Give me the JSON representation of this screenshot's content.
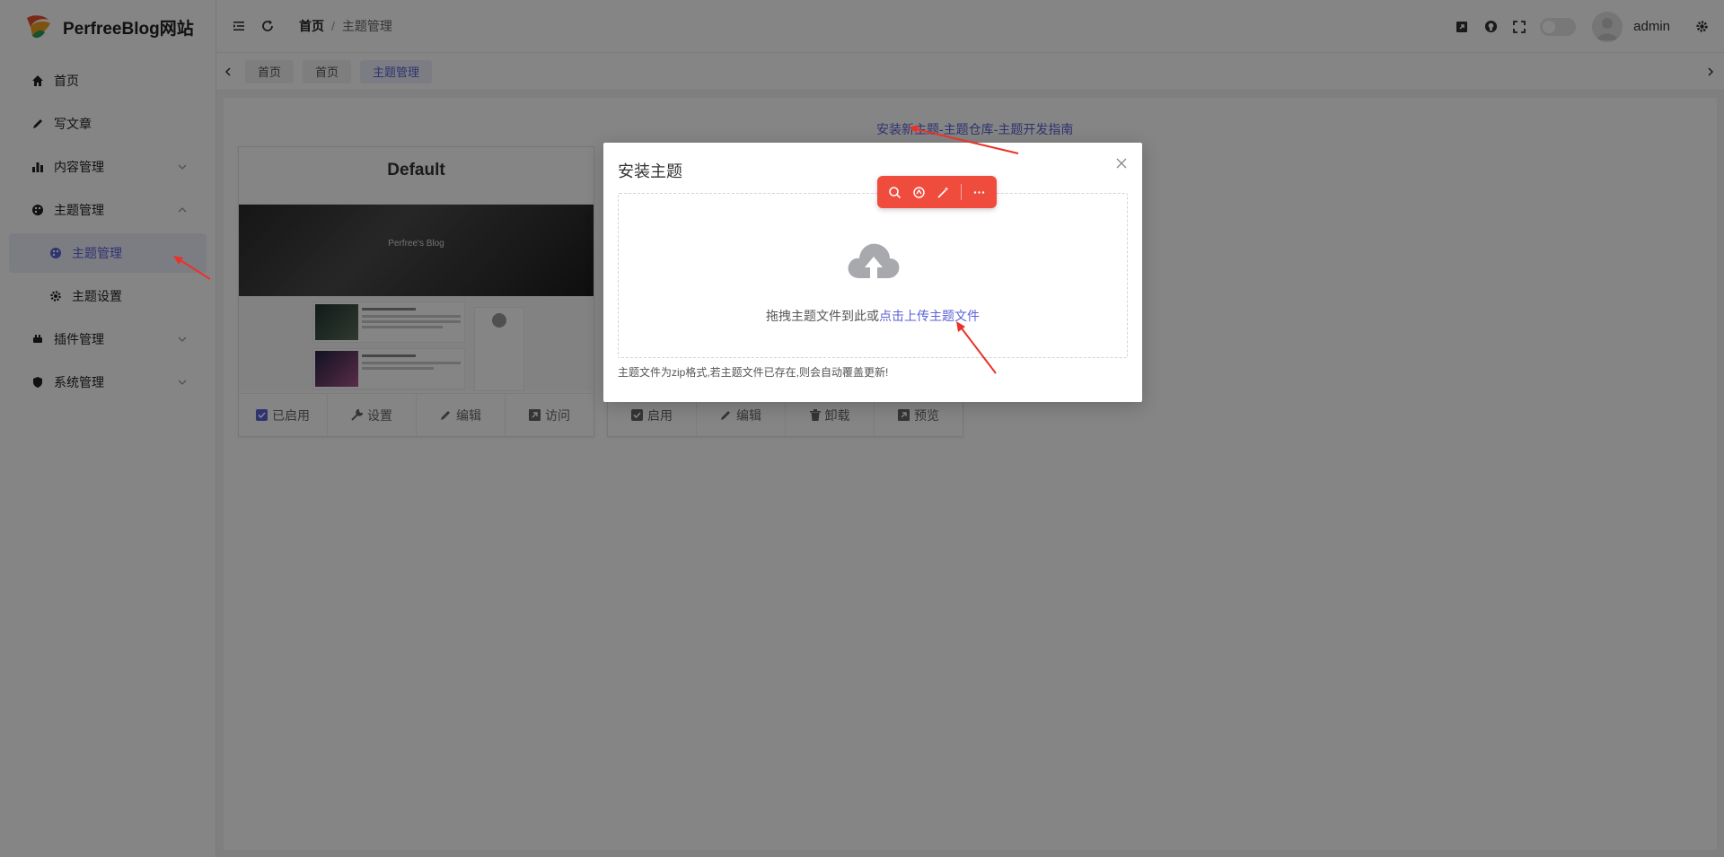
{
  "brand": {
    "title": "PerfreeBlog网站"
  },
  "sidebar": {
    "items": [
      {
        "label": "首页",
        "icon": "home-icon"
      },
      {
        "label": "写文章",
        "icon": "pencil-icon"
      },
      {
        "label": "内容管理",
        "icon": "bar-chart-icon"
      },
      {
        "label": "主题管理",
        "icon": "palette-icon"
      },
      {
        "label": "主题管理",
        "icon": "palette-icon"
      },
      {
        "label": "主题设置",
        "icon": "gear-icon"
      },
      {
        "label": "插件管理",
        "icon": "plugin-icon"
      },
      {
        "label": "系统管理",
        "icon": "shield-icon"
      }
    ]
  },
  "header": {
    "breadcrumb": [
      "首页",
      "主题管理"
    ],
    "separator": "/",
    "user": "admin"
  },
  "tabs": [
    "首页",
    "首页",
    "主题管理"
  ],
  "content": {
    "link_install": "安装新主题",
    "link_sep": "-",
    "link_repo": "主题仓库",
    "link_guide": "主题开发指南",
    "card1": {
      "title": "Default",
      "preview_title": "Perfree's Blog",
      "actions": [
        "已启用",
        "设置",
        "编辑",
        "访问"
      ]
    },
    "card2": {
      "actions": [
        "启用",
        "编辑",
        "卸载",
        "预览"
      ]
    }
  },
  "modal": {
    "title": "安装主题",
    "drop_text": "拖拽主题文件到此或",
    "drop_link": "点击上传主题文件",
    "tip": "主题文件为zip格式,若主题文件已存在,则会自动覆盖更新!"
  },
  "colors": {
    "accent": "#5b62d6",
    "toolbar": "#f04c3e",
    "arrow": "#e8332a"
  }
}
